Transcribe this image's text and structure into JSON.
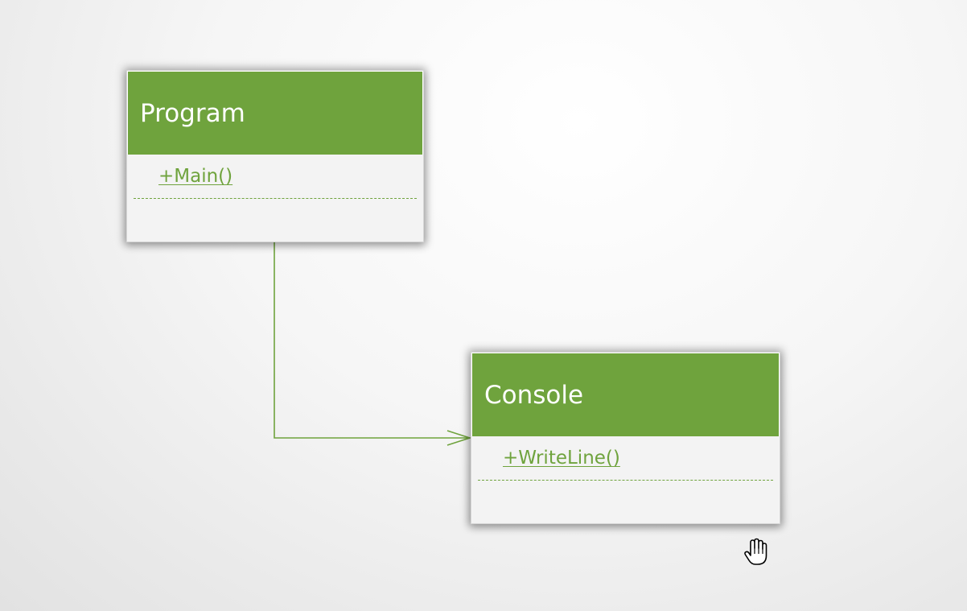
{
  "diagram": {
    "classes": [
      {
        "name": "Program",
        "methods": [
          "+Main()"
        ]
      },
      {
        "name": "Console",
        "methods": [
          "+WriteLine()"
        ]
      }
    ],
    "relationships": [
      {
        "from": "Program",
        "to": "Console",
        "type": "association-arrow"
      }
    ]
  },
  "colors": {
    "accent": "#6fa33d",
    "header_text": "#ffffff",
    "body_bg": "#f3f3f3"
  },
  "icons": {
    "cursor": "hand-pointer-icon"
  }
}
